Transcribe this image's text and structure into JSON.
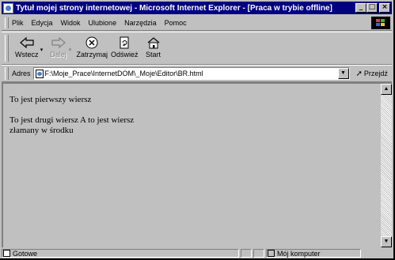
{
  "window": {
    "title": "Tytuł mojej strony internetowej - Microsoft Internet Explorer - [Praca w trybie offline]",
    "min_glyph": "_",
    "max_glyph": "□",
    "close_glyph": "×"
  },
  "menu": {
    "items": [
      "Plik",
      "Edycja",
      "Widok",
      "Ulubione",
      "Narzędzia",
      "Pomoc"
    ]
  },
  "toolbar": {
    "back_label": "Wstecz",
    "forward_label": "Dalej",
    "stop_label": "Zatrzymaj",
    "refresh_label": "Odśwież",
    "home_label": "Start"
  },
  "address": {
    "label": "Adres",
    "url": "F:\\Moje_Prace\\InternetDOM\\_Moje\\Editor\\BR.html",
    "go_label": "Przejdź"
  },
  "document": {
    "line1": "To jest pierwszy wiersz",
    "line2": "To jest drugi wiersz A to jest wiersz",
    "line3": "złamany w środku"
  },
  "status": {
    "text": "Gotowe",
    "zone": "Mój komputer"
  }
}
